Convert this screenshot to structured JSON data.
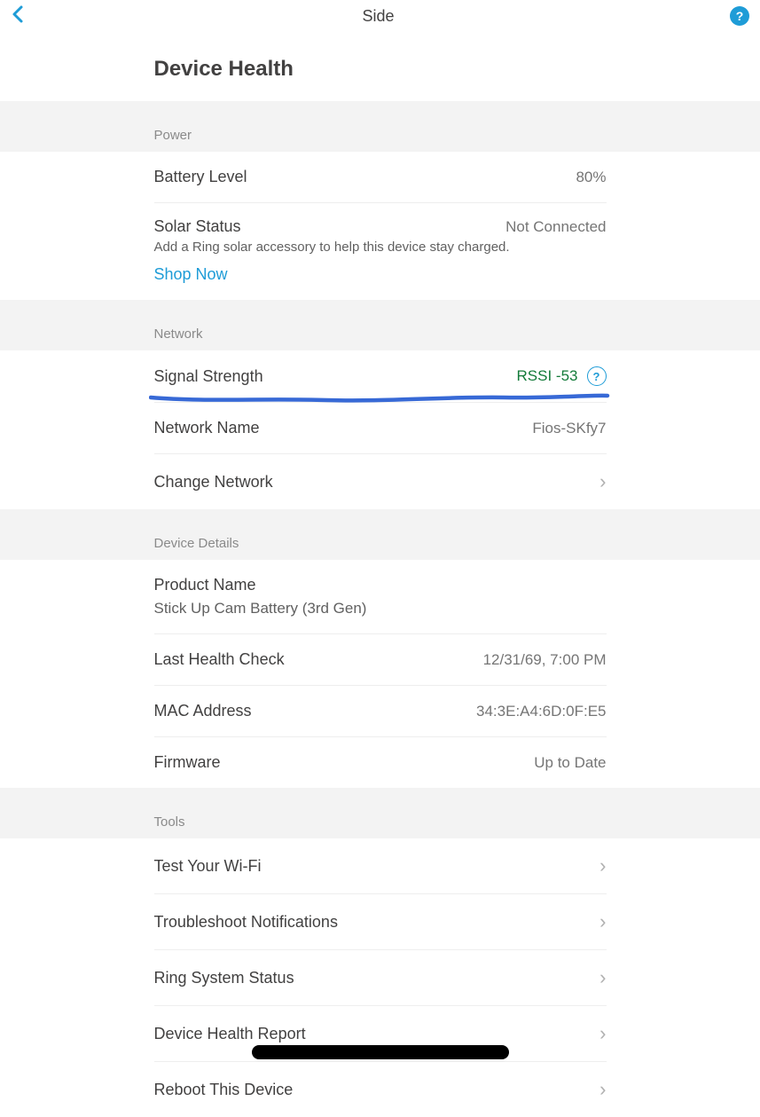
{
  "header": {
    "title": "Side",
    "page_title": "Device Health"
  },
  "sections": {
    "power": {
      "header": "Power",
      "battery_label": "Battery Level",
      "battery_value": "80%",
      "solar_label": "Solar Status",
      "solar_value": "Not Connected",
      "solar_sub": "Add a Ring solar accessory to help this device stay charged.",
      "shop_now": "Shop Now"
    },
    "network": {
      "header": "Network",
      "signal_label": "Signal Strength",
      "signal_value": "RSSI -53",
      "name_label": "Network Name",
      "name_value": "Fios-SKfy7",
      "change_label": "Change Network"
    },
    "details": {
      "header": "Device Details",
      "product_label": "Product Name",
      "product_value": "Stick Up Cam Battery (3rd Gen)",
      "last_check_label": "Last Health Check",
      "last_check_value": "12/31/69, 7:00 PM",
      "mac_label": "MAC Address",
      "mac_value": "34:3E:A4:6D:0F:E5",
      "firmware_label": "Firmware",
      "firmware_value": "Up to Date"
    },
    "tools": {
      "header": "Tools",
      "test_wifi": "Test Your Wi-Fi",
      "troubleshoot": "Troubleshoot Notifications",
      "status": "Ring System Status",
      "report": "Device Health Report",
      "reboot": "Reboot This Device"
    }
  },
  "colors": {
    "accent": "#1e9cd7",
    "underline": "#3769d6",
    "green": "#147b3a"
  }
}
